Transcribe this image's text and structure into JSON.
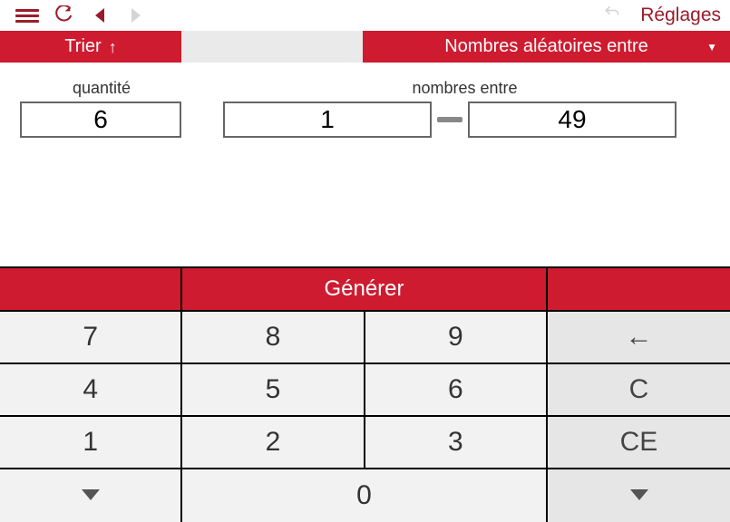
{
  "toolbar": {
    "settings_label": "Réglages"
  },
  "mode": {
    "sort_label": "Trier",
    "main_label": "Nombres aléatoires entre"
  },
  "params": {
    "qty_label": "quantité",
    "between_label": "nombres entre",
    "qty_value": "6",
    "from_value": "1",
    "to_value": "49"
  },
  "keypad": {
    "generate_label": "Générer",
    "keys": {
      "7": "7",
      "8": "8",
      "9": "9",
      "4": "4",
      "5": "5",
      "6": "6",
      "1": "1",
      "2": "2",
      "3": "3",
      "0": "0"
    },
    "backspace": "←",
    "clear": "C",
    "clear_entry": "CE"
  }
}
